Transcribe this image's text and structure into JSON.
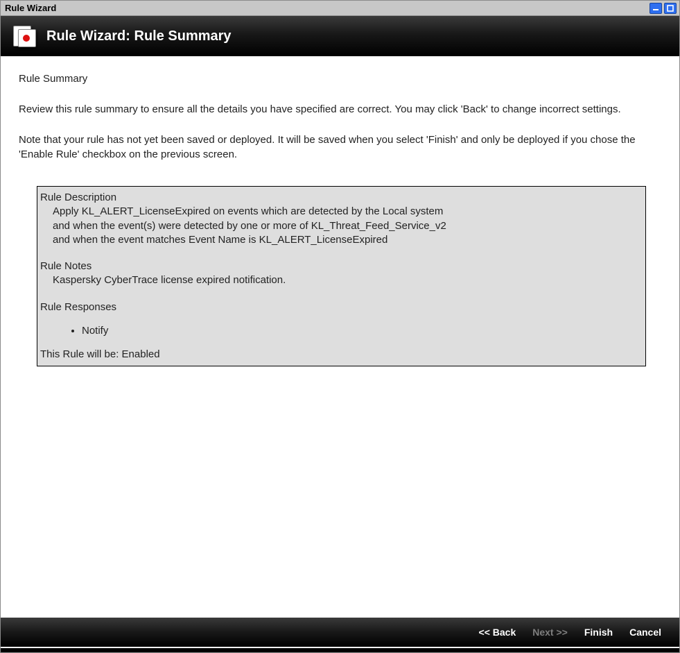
{
  "window": {
    "title": "Rule Wizard"
  },
  "banner": {
    "title": "Rule Wizard: Rule Summary"
  },
  "content": {
    "heading": "Rule Summary",
    "intro": "Review this rule summary to ensure all the details you have specified are correct. You may click 'Back' to change incorrect settings.",
    "note": "Note that your rule has not yet been saved or deployed. It will be saved when you select 'Finish' and only be deployed if you chose the 'Enable Rule' checkbox on the previous screen."
  },
  "summary": {
    "desc_label": "Rule Description",
    "desc_line1": "Apply KL_ALERT_LicenseExpired on events which are detected by the Local system",
    "desc_line2": "and when the event(s) were detected by one or more of KL_Threat_Feed_Service_v2",
    "desc_line3": "and when the event matches Event Name is KL_ALERT_LicenseExpired",
    "notes_label": "Rule Notes",
    "notes_text": "Kaspersky CyberTrace license expired notification.",
    "responses_label": "Rule Responses",
    "responses": [
      "Notify"
    ],
    "status_text": "This Rule will be: Enabled"
  },
  "footer": {
    "back": "<< Back",
    "next": "Next >>",
    "finish": "Finish",
    "cancel": "Cancel"
  }
}
